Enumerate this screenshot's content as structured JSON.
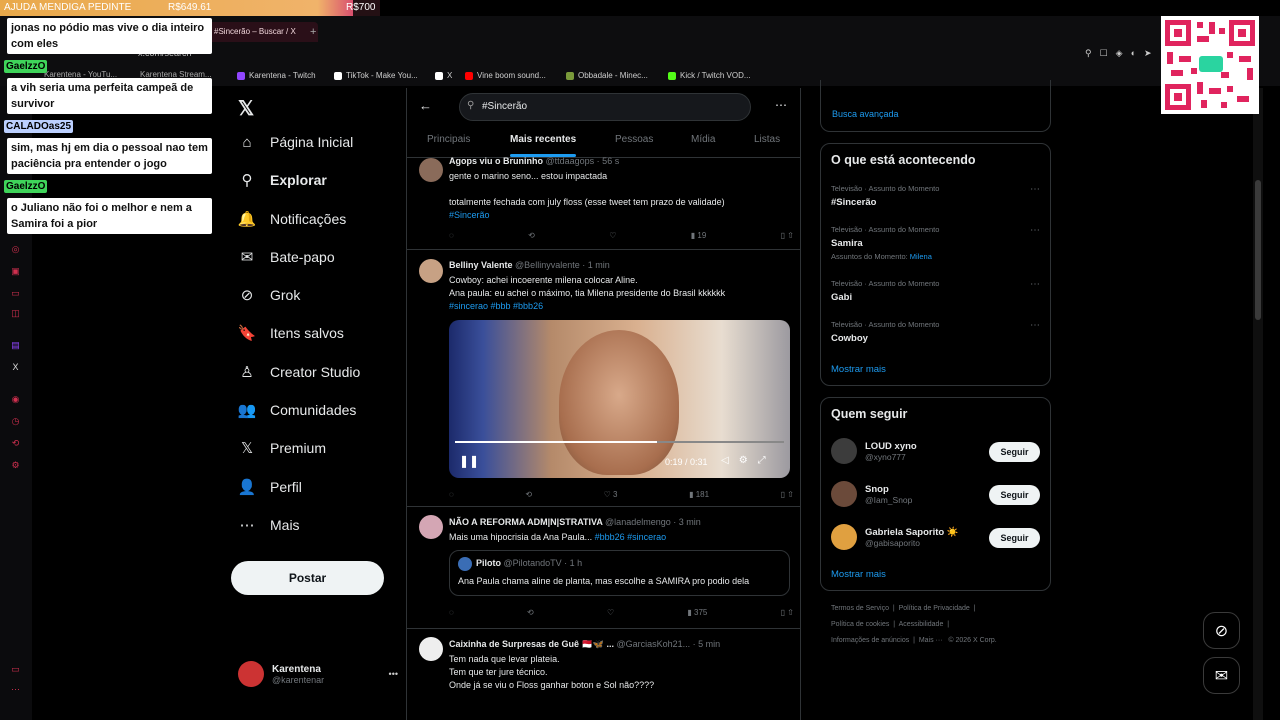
{
  "goal": {
    "title": "AJUDA MENDIGA PEDINTE",
    "current": "R$649.61",
    "target": "R$700",
    "progress": 0.93
  },
  "browser": {
    "active_tab": "#Sincerão – Buscar / X",
    "url": "x.com/search",
    "tabs": [
      "Karentena - YouTu...",
      "Karentena Stream..."
    ],
    "bookmarks": [
      {
        "label": "Karentena - Twitch",
        "color": "#9146ff"
      },
      {
        "label": "TikTok - Make You...",
        "color": "#ffffff"
      },
      {
        "label": "X",
        "color": "#ffffff"
      },
      {
        "label": "Vine boom sound...",
        "color": "#ff0000"
      },
      {
        "label": "Obbadale - Minec...",
        "color": "#7a9a3a"
      },
      {
        "label": "Kick / Twitch VOD...",
        "color": "#53fc18"
      }
    ]
  },
  "chat": [
    {
      "user": "",
      "text": "jonas no pódio mas vive o dia inteiro com eles"
    },
    {
      "user": "GaelzzO",
      "text": "a vih seria uma perfeita campeã de survivor",
      "user_color": "#3fd45a"
    },
    {
      "user": "CALADOas25",
      "text": "sim, mas hj em dia o pessoal nao tem paciência pra entender o jogo",
      "user_color": "#bcd0ff"
    },
    {
      "user": "GaelzzO",
      "text": "o Juliano não foi o melhor e nem a Samira foi a pior",
      "user_color": "#3fd45a"
    }
  ],
  "nav": {
    "items": [
      {
        "label": "Página Inicial",
        "icon": "home-icon",
        "glyph": "⌂"
      },
      {
        "label": "Explorar",
        "icon": "search-icon",
        "glyph": "⚲"
      },
      {
        "label": "Notificações",
        "icon": "bell-icon",
        "glyph": "🔔"
      },
      {
        "label": "Bate-papo",
        "icon": "mail-icon",
        "glyph": "✉"
      },
      {
        "label": "Grok",
        "icon": "grok-icon",
        "glyph": "⊘"
      },
      {
        "label": "Itens salvos",
        "icon": "bookmark-icon",
        "glyph": "🔖"
      },
      {
        "label": "Creator Studio",
        "icon": "creator-icon",
        "glyph": "♙"
      },
      {
        "label": "Comunidades",
        "icon": "communities-icon",
        "glyph": "👥"
      },
      {
        "label": "Premium",
        "icon": "x-logo-icon",
        "glyph": "𝕏"
      },
      {
        "label": "Perfil",
        "icon": "person-icon",
        "glyph": "👤"
      },
      {
        "label": "Mais",
        "icon": "more-icon",
        "glyph": "⋯"
      }
    ],
    "post_label": "Postar",
    "profile": {
      "name": "Karentena",
      "handle": "@karentenar",
      "more": "•••"
    }
  },
  "search": {
    "query": "#Sincerão",
    "tabs": [
      "Principais",
      "Mais recentes",
      "Pessoas",
      "Mídia",
      "Listas"
    ],
    "active_tab": "Mais recentes"
  },
  "tweets": [
    {
      "name": "Agops viu o Bruninho",
      "handle": "@ttdaagops · 56 s",
      "lines": [
        "gente o marino seno... estou impactada",
        "",
        "totalmente fechada com july floss (esse tweet tem prazo de validade)"
      ],
      "tags": "#Sincerão",
      "views": "19",
      "likes": "",
      "retweets": ""
    },
    {
      "name": "Belliny Valente",
      "handle": "@Bellinyvalente · 1 min",
      "lines": [
        "Cowboy: achei incoerente milena colocar Aline.",
        "Ana paula: eu achei o máximo, tia Milena presidente do Brasil kkkkkk"
      ],
      "tags": "#sincerao #bbb #bbb26",
      "views": "181",
      "likes": "3",
      "video_time": "0:19 / 0:31"
    },
    {
      "name": "NÃO A REFORMA ADM|N|STRATIVA",
      "handle": "@lanadelmengo · 3 min",
      "lines": [
        "Mais uma hipocrisia da Ana Paula..."
      ],
      "tags": "#bbb26 #sincerao",
      "views": "375",
      "quote": {
        "name": "Piloto",
        "handle": "@PilotandoTV · 1 h",
        "text": "Ana Paula chama aline de planta, mas escolhe a SAMIRA pro podio dela"
      }
    },
    {
      "name": "Caixinha de Surpresas de Guê 🇲🇨🦋 ...",
      "handle": "@GarciasKoh21... · 5 min",
      "lines": [
        "Tem nada que levar plateia.",
        "Tem que ter jure técnico.",
        "Onde já se viu o Floss ganhar boton e Sol não????"
      ]
    }
  ],
  "sidebar": {
    "advanced": "Busca avançada",
    "trending_title": "O que está acontecendo",
    "trends": [
      {
        "meta": "Televisão · Assunto do Momento",
        "name": "#Sincerão",
        "extra": ""
      },
      {
        "meta": "Televisão · Assunto do Momento",
        "name": "Samira",
        "extra": "Assuntos do Momento: ",
        "extra_link": "Milena"
      },
      {
        "meta": "Televisão · Assunto do Momento",
        "name": "Gabi",
        "extra": ""
      },
      {
        "meta": "Televisão · Assunto do Momento",
        "name": "Cowboy",
        "extra": ""
      }
    ],
    "show_more": "Mostrar mais",
    "who_title": "Quem seguir",
    "follow": [
      {
        "name": "LOUD xyno",
        "handle": "@xyno777",
        "btn": "Seguir"
      },
      {
        "name": "Snop",
        "handle": "@Iam_Snop",
        "btn": "Seguir"
      },
      {
        "name": "Gabriela Saporito ☀️",
        "handle": "@gabisaporito",
        "btn": "Seguir"
      }
    ],
    "show_more2": "Mostrar mais",
    "footer": [
      "Termos de Serviço",
      "Política de Privacidade",
      "Política de cookies",
      "Acessibilidade",
      "Informações de anúncios",
      "Mais ···",
      "© 2026 X Corp."
    ]
  }
}
